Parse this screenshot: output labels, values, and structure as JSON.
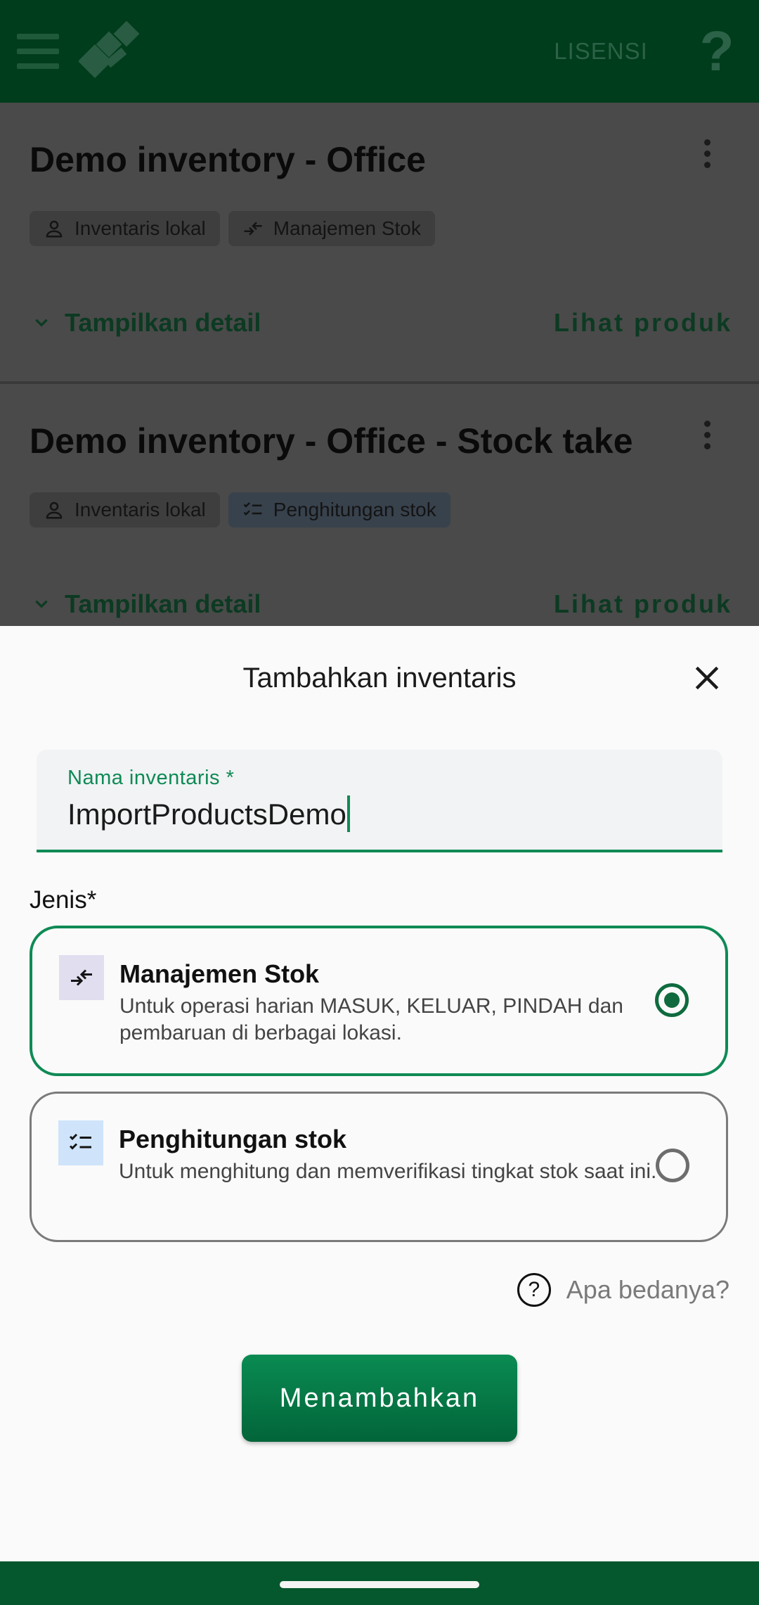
{
  "appbar": {
    "license_label": "LISENSI",
    "help_label": "?",
    "menu_icon": "hamburger-icon",
    "logo_icon": "app-logo"
  },
  "inventories": [
    {
      "title": "Demo inventory - Office",
      "chips": [
        {
          "icon": "person-icon",
          "label": "Inventaris lokal"
        },
        {
          "icon": "stock-management-icon",
          "label": "Manajemen Stok"
        }
      ],
      "detail_label": "Tampilkan detail",
      "products_label": "Lihat produk"
    },
    {
      "title": "Demo inventory - Office - Stock take",
      "chips": [
        {
          "icon": "person-icon",
          "label": "Inventaris lokal"
        },
        {
          "icon": "checklist-icon",
          "label": "Penghitungan stok"
        }
      ],
      "detail_label": "Tampilkan detail",
      "products_label": "Lihat produk"
    }
  ],
  "sheet": {
    "title": "Tambahkan inventaris",
    "name_field": {
      "label": "Nama inventaris *",
      "value": "ImportProductsDemo"
    },
    "type_label": "Jenis*",
    "options": [
      {
        "title": "Manajemen Stok",
        "description": "Untuk operasi harian MASUK, KELUAR, PINDAH dan pembaruan di berbagai lokasi.",
        "selected": true,
        "icon": "stock-management-icon"
      },
      {
        "title": "Penghitungan stok",
        "description": "Untuk menghitung dan memverifikasi tingkat stok saat ini.",
        "selected": false,
        "icon": "checklist-icon"
      }
    ],
    "help_link": "Apa bedanya?",
    "help_glyph": "?",
    "submit_label": "Menambahkan"
  },
  "colors": {
    "accent": "#0f8a55",
    "appbar": "#003d1c",
    "button": "#02653a"
  }
}
